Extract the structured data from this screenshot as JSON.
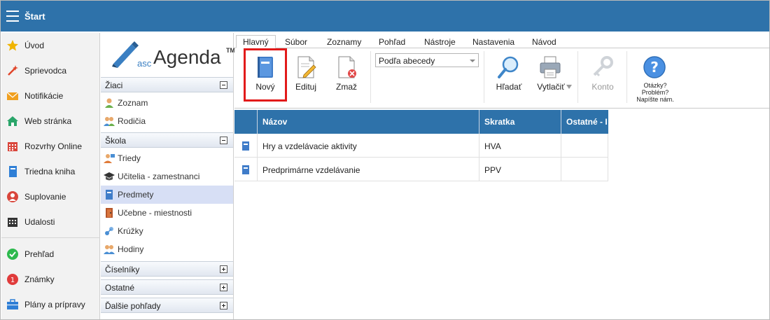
{
  "topbar": {
    "title": "Štart"
  },
  "leftnav": {
    "items": [
      {
        "label": "Úvod",
        "icon": "star-icon",
        "color": "#f0b400"
      },
      {
        "label": "Sprievodca",
        "icon": "magic-wand-icon",
        "color": "#e0452a"
      },
      {
        "label": "Notifikácie",
        "icon": "envelope-icon",
        "color": "#f0a020"
      },
      {
        "label": "Web stránka",
        "icon": "house-icon",
        "color": "#2aa56a"
      },
      {
        "label": "Rozvrhy Online",
        "icon": "calendar-icon",
        "color": "#d9463b"
      },
      {
        "label": "Triedna kniha",
        "icon": "book-icon",
        "color": "#2f7fd6"
      },
      {
        "label": "Suplovanie",
        "icon": "person-icon",
        "color": "#d9463b"
      },
      {
        "label": "Udalosti",
        "icon": "calendar-dark-icon",
        "color": "#333333"
      },
      {
        "label": "Prehľad",
        "icon": "check-circle-icon",
        "color": "#2db94d"
      },
      {
        "label": "Známky",
        "icon": "grade-icon",
        "color": "#e03b3b"
      },
      {
        "label": "Plány a prípravy",
        "icon": "briefcase-icon",
        "color": "#2f7fd6"
      }
    ]
  },
  "logo": {
    "asc": "asc",
    "agenda": "Agenda",
    "tm": "TM"
  },
  "sections": {
    "ziaci": {
      "title": "Žiaci",
      "items": [
        "Zoznam",
        "Rodičia"
      ]
    },
    "skola": {
      "title": "Škola",
      "items": [
        "Triedy",
        "Učitelia - zamestnanci",
        "Predmety",
        "Učebne - miestnosti",
        "Krúžky",
        "Hodiny"
      ]
    },
    "ciselniky": {
      "title": "Číselníky"
    },
    "ostatne": {
      "title": "Ostatné"
    },
    "dalsie": {
      "title": "Ďalšie pohľady"
    }
  },
  "tabs": [
    "Hlavný",
    "Súbor",
    "Zoznamy",
    "Pohľad",
    "Nástroje",
    "Nastavenia",
    "Návod"
  ],
  "toolbar": {
    "new_label": "Nový",
    "edit_label": "Edituj",
    "delete_label": "Zmaž",
    "sort_value": "Podľa abecedy",
    "search_label": "Hľadať",
    "print_label": "Vytlačiť",
    "account_label": "Konto",
    "help_line1": "Otázky?",
    "help_line2": "Problém?",
    "help_line3": "Napíšte nám."
  },
  "grid": {
    "headers": [
      "Názov",
      "Skratka",
      "Ostatné - I"
    ],
    "rows": [
      {
        "name": "Hry a vzdelávacie aktivity",
        "abbr": "HVA",
        "other": ""
      },
      {
        "name": "Predprimárne vzdelávanie",
        "abbr": "PPV",
        "other": ""
      }
    ]
  },
  "colors": {
    "accent": "#2e72aa",
    "highlight": "#e21a1a",
    "selected_row": "#d7dff5"
  }
}
